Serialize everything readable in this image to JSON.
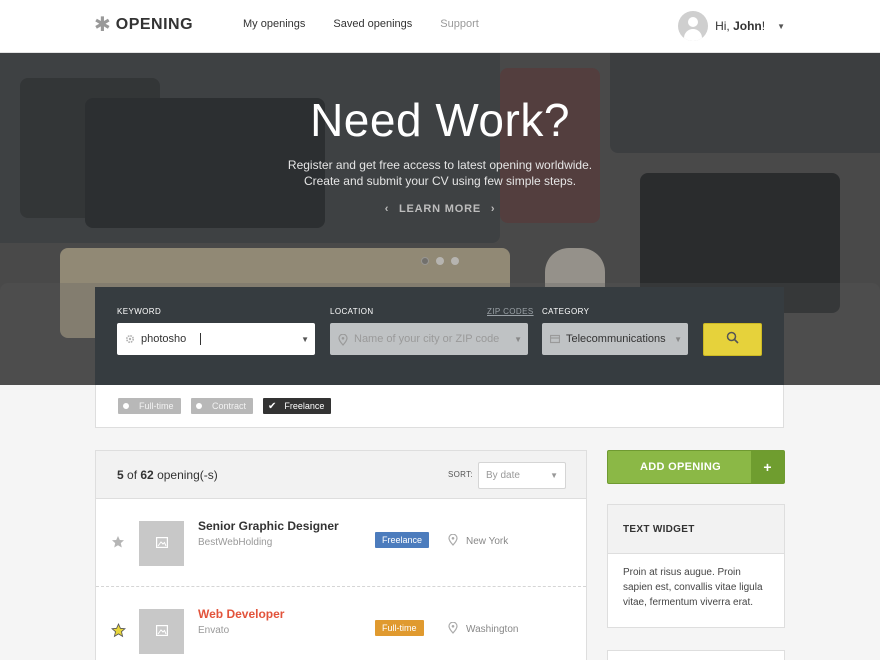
{
  "header": {
    "logo": "OPENING",
    "nav": [
      {
        "label": "My openings"
      },
      {
        "label": "Saved openings"
      },
      {
        "label": "Support"
      }
    ],
    "greeting_prefix": "Hi, ",
    "user_name": "John",
    "greeting_suffix": "!"
  },
  "hero": {
    "title": "Need Work?",
    "subtitle": "Register and get free access to latest opening worldwide. Create and submit your CV using few simple steps.",
    "learn_more": "LEARN MORE"
  },
  "search": {
    "keyword_label": "KEYWORD",
    "keyword_value": "photosho",
    "location_label": "LOCATION",
    "zip_codes": "ZIP CODES",
    "location_placeholder": "Name of your city or ZIP code",
    "category_label": "CATEGORY",
    "category_value": "Telecommunications"
  },
  "filters": [
    {
      "label": "Full-time",
      "checked": false
    },
    {
      "label": "Contract",
      "checked": false
    },
    {
      "label": "Freelance",
      "checked": true
    }
  ],
  "results": {
    "shown": "5",
    "of": " of ",
    "total": "62",
    "suffix": " opening(-s)",
    "sort_label": "SORT:",
    "sort_value": "By date",
    "jobs": [
      {
        "title": "Senior Graphic Designer",
        "company": "BestWebHolding",
        "type": "Freelance",
        "location": "New York",
        "starred": false
      },
      {
        "title": "Web Developer",
        "company": "Envato",
        "type": "Full-time",
        "location": "Washington",
        "starred": true
      }
    ]
  },
  "sidebar": {
    "add_opening": "ADD OPENING",
    "add_plus": "+",
    "widget_title": "TEXT WIDGET",
    "widget_text": "Proin at risus augue. Proin sapien est, convallis vitae ligula vitae, fermentum viverra erat."
  },
  "colors": {
    "accent_green": "#8bb846",
    "search_yellow": "#e6d23b",
    "search_panel": "#363c40",
    "badge_blue": "#4c7cbd",
    "badge_orange": "#e09a2f",
    "hot_title": "#e2533b"
  },
  "icons": [
    "asterisk-logo-icon",
    "user-avatar-icon",
    "chevron-left-icon",
    "chevron-right-icon",
    "gear-icon",
    "map-pin-icon",
    "category-icon",
    "search-icon",
    "check-icon",
    "star-icon",
    "image-placeholder-icon",
    "plus-icon"
  ]
}
